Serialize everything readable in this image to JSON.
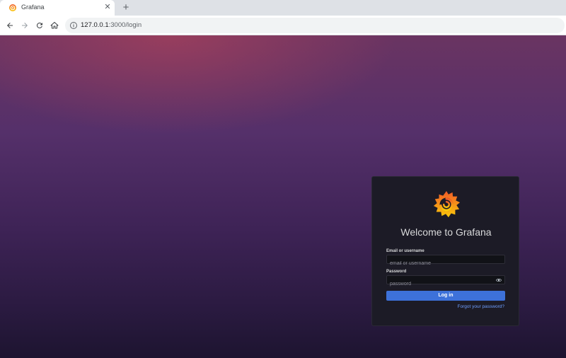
{
  "browser": {
    "tab": {
      "title": "Grafana",
      "close_glyph": "✕",
      "favicon": "grafana-favicon-icon"
    },
    "new_tab_glyph": "+",
    "toolbar": {
      "back_icon": "back-arrow-icon",
      "forward_icon": "forward-arrow-icon",
      "reload_icon": "reload-icon",
      "home_icon": "home-icon",
      "info_icon": "site-info-icon"
    },
    "url": {
      "host": "127.0.0.1",
      "path": ":3000/login"
    }
  },
  "login": {
    "title": "Welcome to Grafana",
    "username": {
      "label": "Email or username",
      "placeholder": "email or username",
      "value": ""
    },
    "password": {
      "label": "Password",
      "placeholder": "password",
      "value": ""
    },
    "submit_label": "Log in",
    "forgot_label": "Forgot your password?"
  },
  "colors": {
    "accent": "#3d71d9",
    "link": "#6e9fff",
    "card": "#1c1b26",
    "logo_orange": "#f46800",
    "logo_yellow": "#fbca0a"
  }
}
